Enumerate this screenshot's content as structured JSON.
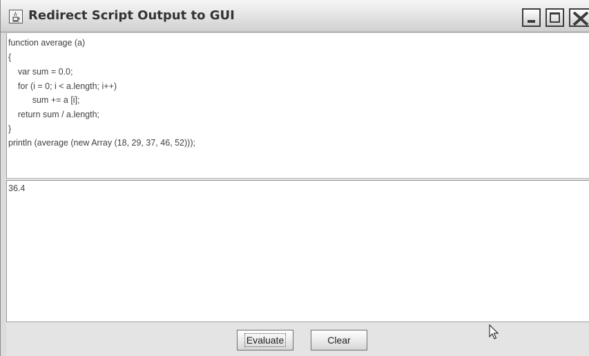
{
  "window": {
    "title": "Redirect Script Output to GUI"
  },
  "code_editor": {
    "lines": [
      "function average (a)",
      "{",
      "    var sum = 0.0;",
      "    for (i = 0; i < a.length; i++)",
      "          sum += a [i];",
      "    return sum / a.length;",
      "}",
      "println (average (new Array (18, 29, 37, 46, 52)));"
    ]
  },
  "output": {
    "text": "36.4"
  },
  "buttons": {
    "evaluate_label": "Evaluate",
    "clear_label": "Clear"
  },
  "icons": {
    "app": "java-cup-icon",
    "minimize": "minimize-icon",
    "maximize": "maximize-icon",
    "close": "close-icon",
    "cursor": "mouse-pointer-icon"
  }
}
